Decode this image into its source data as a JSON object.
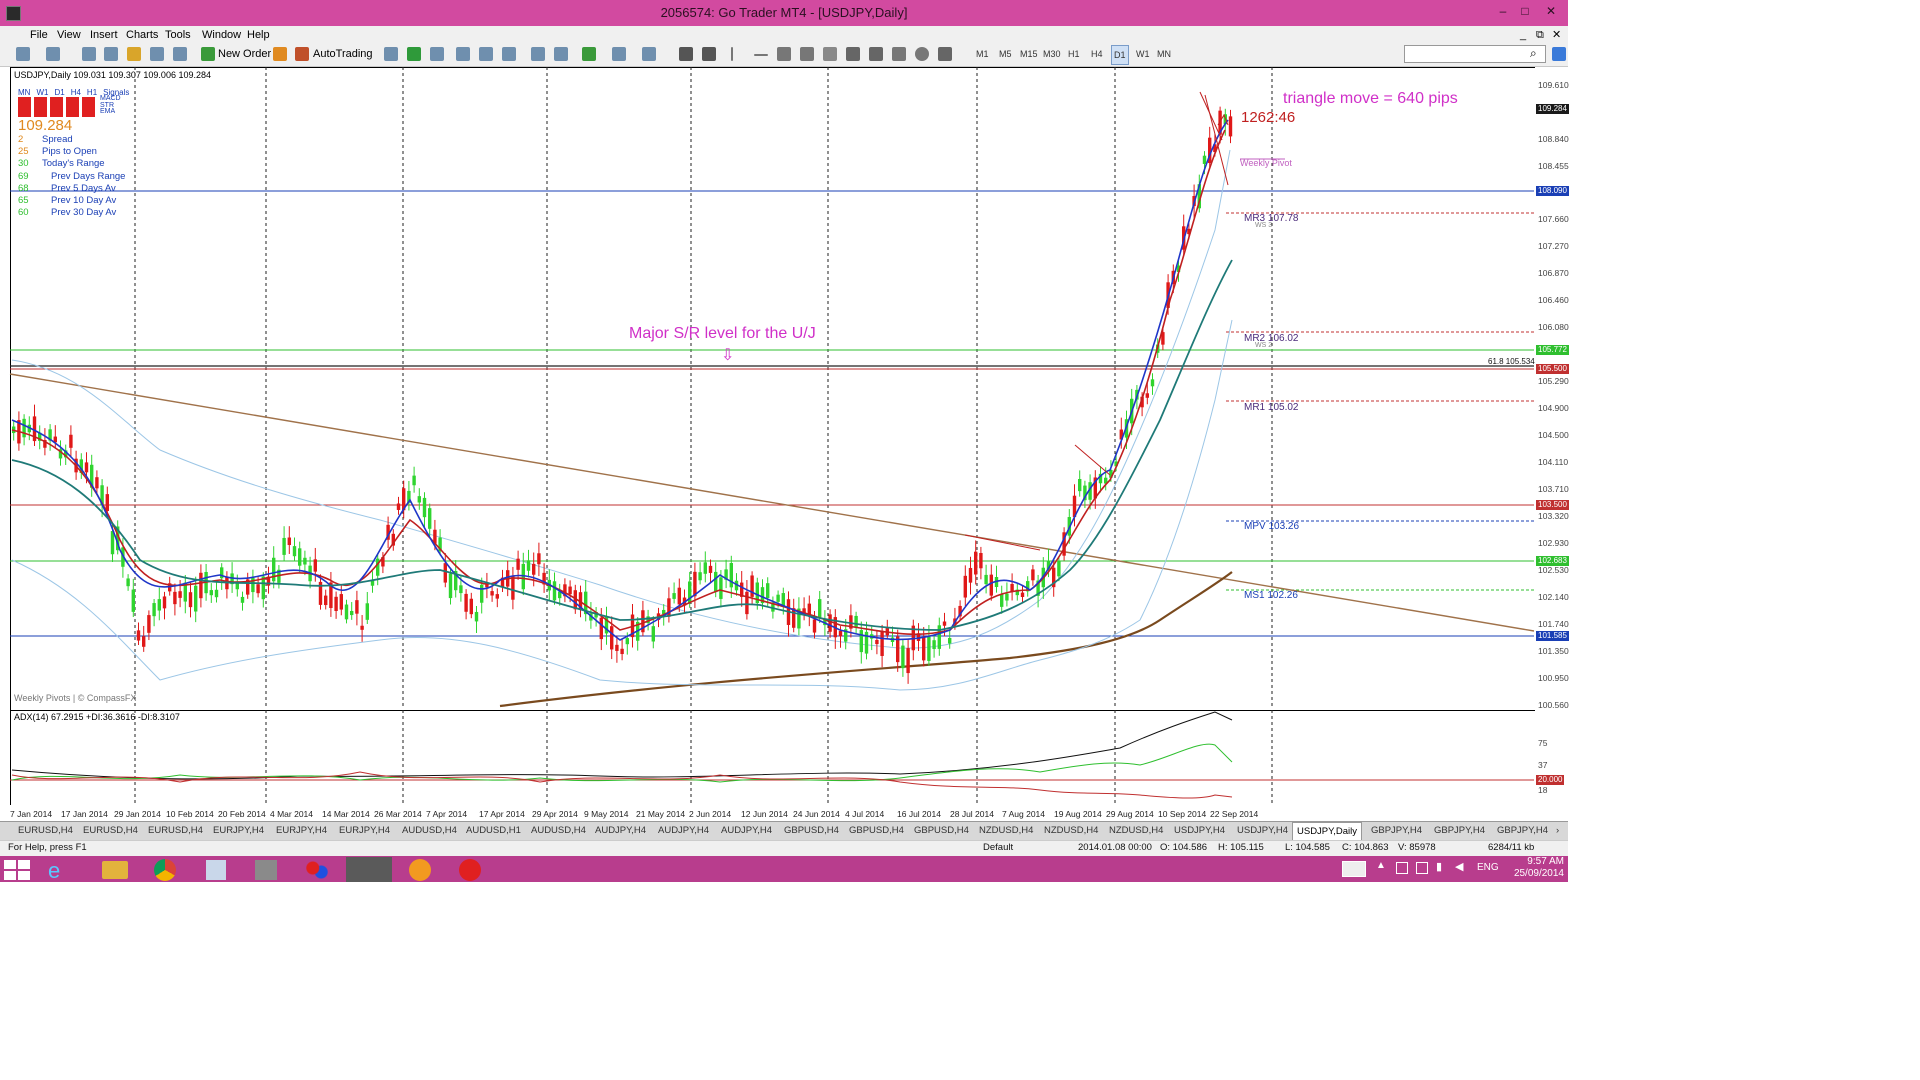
{
  "window": {
    "title": "2056574: Go Trader MT4 - [USDJPY,Daily]",
    "controls": [
      "–",
      "□",
      "✕"
    ],
    "inner_controls": [
      "_",
      "⧉",
      "✕"
    ]
  },
  "menu": [
    "File",
    "View",
    "Insert",
    "Charts",
    "Tools",
    "Window",
    "Help"
  ],
  "toolbar": {
    "new_order": "New Order",
    "autotrading": "AutoTrading",
    "timeframes": [
      "M1",
      "M5",
      "M15",
      "M30",
      "H1",
      "H4",
      "D1",
      "W1",
      "MN"
    ]
  },
  "chart": {
    "header": "USDJPY,Daily  109.031 109.307 109.006 109.284",
    "signals": {
      "cols": [
        "MN",
        "W1",
        "D1",
        "H4",
        "H1"
      ],
      "label": "Signals",
      "rows": [
        "MACD",
        "STR",
        "EMA"
      ]
    },
    "price": "109.284",
    "stats": [
      {
        "val": "2",
        "label": "Spread"
      },
      {
        "val": "25",
        "label": "Pips to Open"
      },
      {
        "val": "30",
        "label": "Today's Range"
      },
      {
        "val": "69",
        "label": "Prev Days Range"
      },
      {
        "val": "68",
        "label": "Prev 5 Days Av"
      },
      {
        "val": "65",
        "label": "Prev 10 Day Av"
      },
      {
        "val": "60",
        "label": "Prev 30 Day Av"
      }
    ],
    "annotation_triangle": "triangle move = 640 pips",
    "countdown": "1262:46",
    "weekly_pivot": "Weekly Pivot",
    "annotation_sr": "Major S/R level for the U/J",
    "arrow": "⇩",
    "fib": "61.8 105.534",
    "watermark": "Weekly Pivots | © CompassFX",
    "pivots": [
      {
        "name": "MR3",
        "value": "107.78",
        "sub": "WS 3"
      },
      {
        "name": "MR2",
        "value": "106.02",
        "sub": "WS 2"
      },
      {
        "name": "MR1",
        "value": "105.02"
      },
      {
        "name": "MPV",
        "value": "103.26"
      },
      {
        "name": "MS1",
        "value": "102.26"
      }
    ],
    "price_scale": [
      "109.610",
      "108.840",
      "108.455",
      "108.070",
      "107.660",
      "107.270",
      "106.870",
      "106.460",
      "106.080",
      "105.290",
      "104.900",
      "104.500",
      "104.110",
      "103.710",
      "103.320",
      "102.930",
      "102.530",
      "102.140",
      "101.740",
      "101.350",
      "100.950",
      "100.560"
    ],
    "price_tags": [
      {
        "label": "109.284",
        "color": "#1a1a1a"
      },
      {
        "label": "108.090",
        "color": "#1a3fb5"
      },
      {
        "label": "105.772",
        "color": "#2fbf2f"
      },
      {
        "label": "105.500",
        "color": "#c03030"
      },
      {
        "label": "103.500",
        "color": "#c03030"
      },
      {
        "label": "102.683",
        "color": "#2fbf2f"
      },
      {
        "label": "101.585",
        "color": "#1a3fb5"
      }
    ],
    "dates": [
      "7 Jan 2014",
      "17 Jan 2014",
      "29 Jan 2014",
      "10 Feb 2014",
      "20 Feb 2014",
      "4 Mar 2014",
      "14 Mar 2014",
      "26 Mar 2014",
      "7 Apr 2014",
      "17 Apr 2014",
      "29 Apr 2014",
      "9 May 2014",
      "21 May 2014",
      "2 Jun 2014",
      "12 Jun 2014",
      "24 Jun 2014",
      "4 Jul 2014",
      "16 Jul 2014",
      "28 Jul 2014",
      "7 Aug 2014",
      "19 Aug 2014",
      "29 Aug 2014",
      "10 Sep 2014",
      "22 Sep 2014"
    ],
    "indicator": {
      "header": "ADX(14) 67.2915 +DI:36.3616 -DI:8.3107",
      "scale": [
        "75",
        "37",
        "18"
      ],
      "level_tag": "20.000"
    }
  },
  "tabs": [
    "EURUSD,H4",
    "EURUSD,H4",
    "EURUSD,H4",
    "EURJPY,H4",
    "EURJPY,H4",
    "EURJPY,H4",
    "AUDUSD,H4",
    "AUDUSD,H1",
    "AUDUSD,H4",
    "AUDJPY,H4",
    "AUDJPY,H4",
    "AUDJPY,H4",
    "GBPUSD,H4",
    "GBPUSD,H4",
    "GBPUSD,H4",
    "NZDUSD,H4",
    "NZDUSD,H4",
    "NZDUSD,H4",
    "USDJPY,H4",
    "USDJPY,H4",
    "USDJPY,Daily",
    "GBPJPY,H4",
    "GBPJPY,H4",
    "GBPJPY,H4"
  ],
  "tabs_active_index": 20,
  "status": {
    "help": "For Help, press F1",
    "profile": "Default",
    "time": "2014.01.08 00:00",
    "open": "O: 104.586",
    "high": "H: 105.115",
    "low": "L: 104.585",
    "close": "C: 104.863",
    "volume": "V: 85978",
    "traffic": "6284/11 kb"
  },
  "taskbar": {
    "lang": "ENG",
    "time": "9:57 AM",
    "date": "25/09/2014"
  }
}
